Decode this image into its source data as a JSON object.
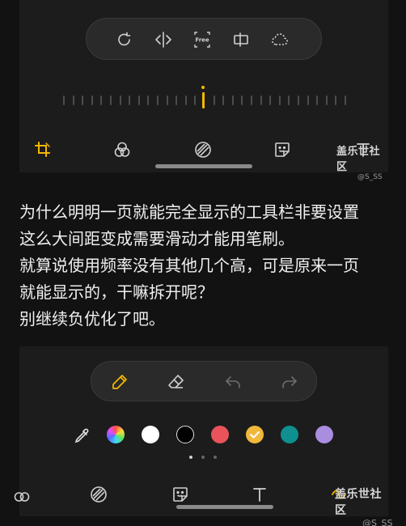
{
  "top_panel": {
    "toolbar": [
      {
        "name": "rotate-icon"
      },
      {
        "name": "flip-icon"
      },
      {
        "name": "free-crop-icon",
        "label": "Free"
      },
      {
        "name": "aspect-icon"
      },
      {
        "name": "lasso-icon"
      }
    ],
    "bottom_tabs": [
      "crop-icon",
      "filters-icon",
      "tone-icon",
      "sticker-icon"
    ],
    "active_color": "#f5b800"
  },
  "post": {
    "lines": [
      "为什么明明一页就能完全显示的工具栏非要设置",
      "这么大间距变成需要滑动才能用笔刷。",
      "就算说使用频率没有其他几个高，可是原来一页",
      "就能显示的，干嘛拆开呢？",
      "别继续负优化了吧。"
    ]
  },
  "bottom_panel": {
    "toolbar": [
      "pen-icon",
      "eraser-icon",
      "undo-icon",
      "redo-icon"
    ],
    "colors": [
      "#ffffff",
      "#000000",
      "#e8545a",
      "#f1b93b",
      "#0f8f8f",
      "#a98ee0"
    ],
    "selected_color": "#f1b93b",
    "bottom_tabs": [
      "tone-icon",
      "sticker-icon",
      "text-icon"
    ]
  },
  "watermark_top": {
    "title": "盖乐世社区",
    "user": "@S_SS"
  },
  "watermark_bottom": {
    "title": "盖乐世社区",
    "user": "@S_SS"
  }
}
